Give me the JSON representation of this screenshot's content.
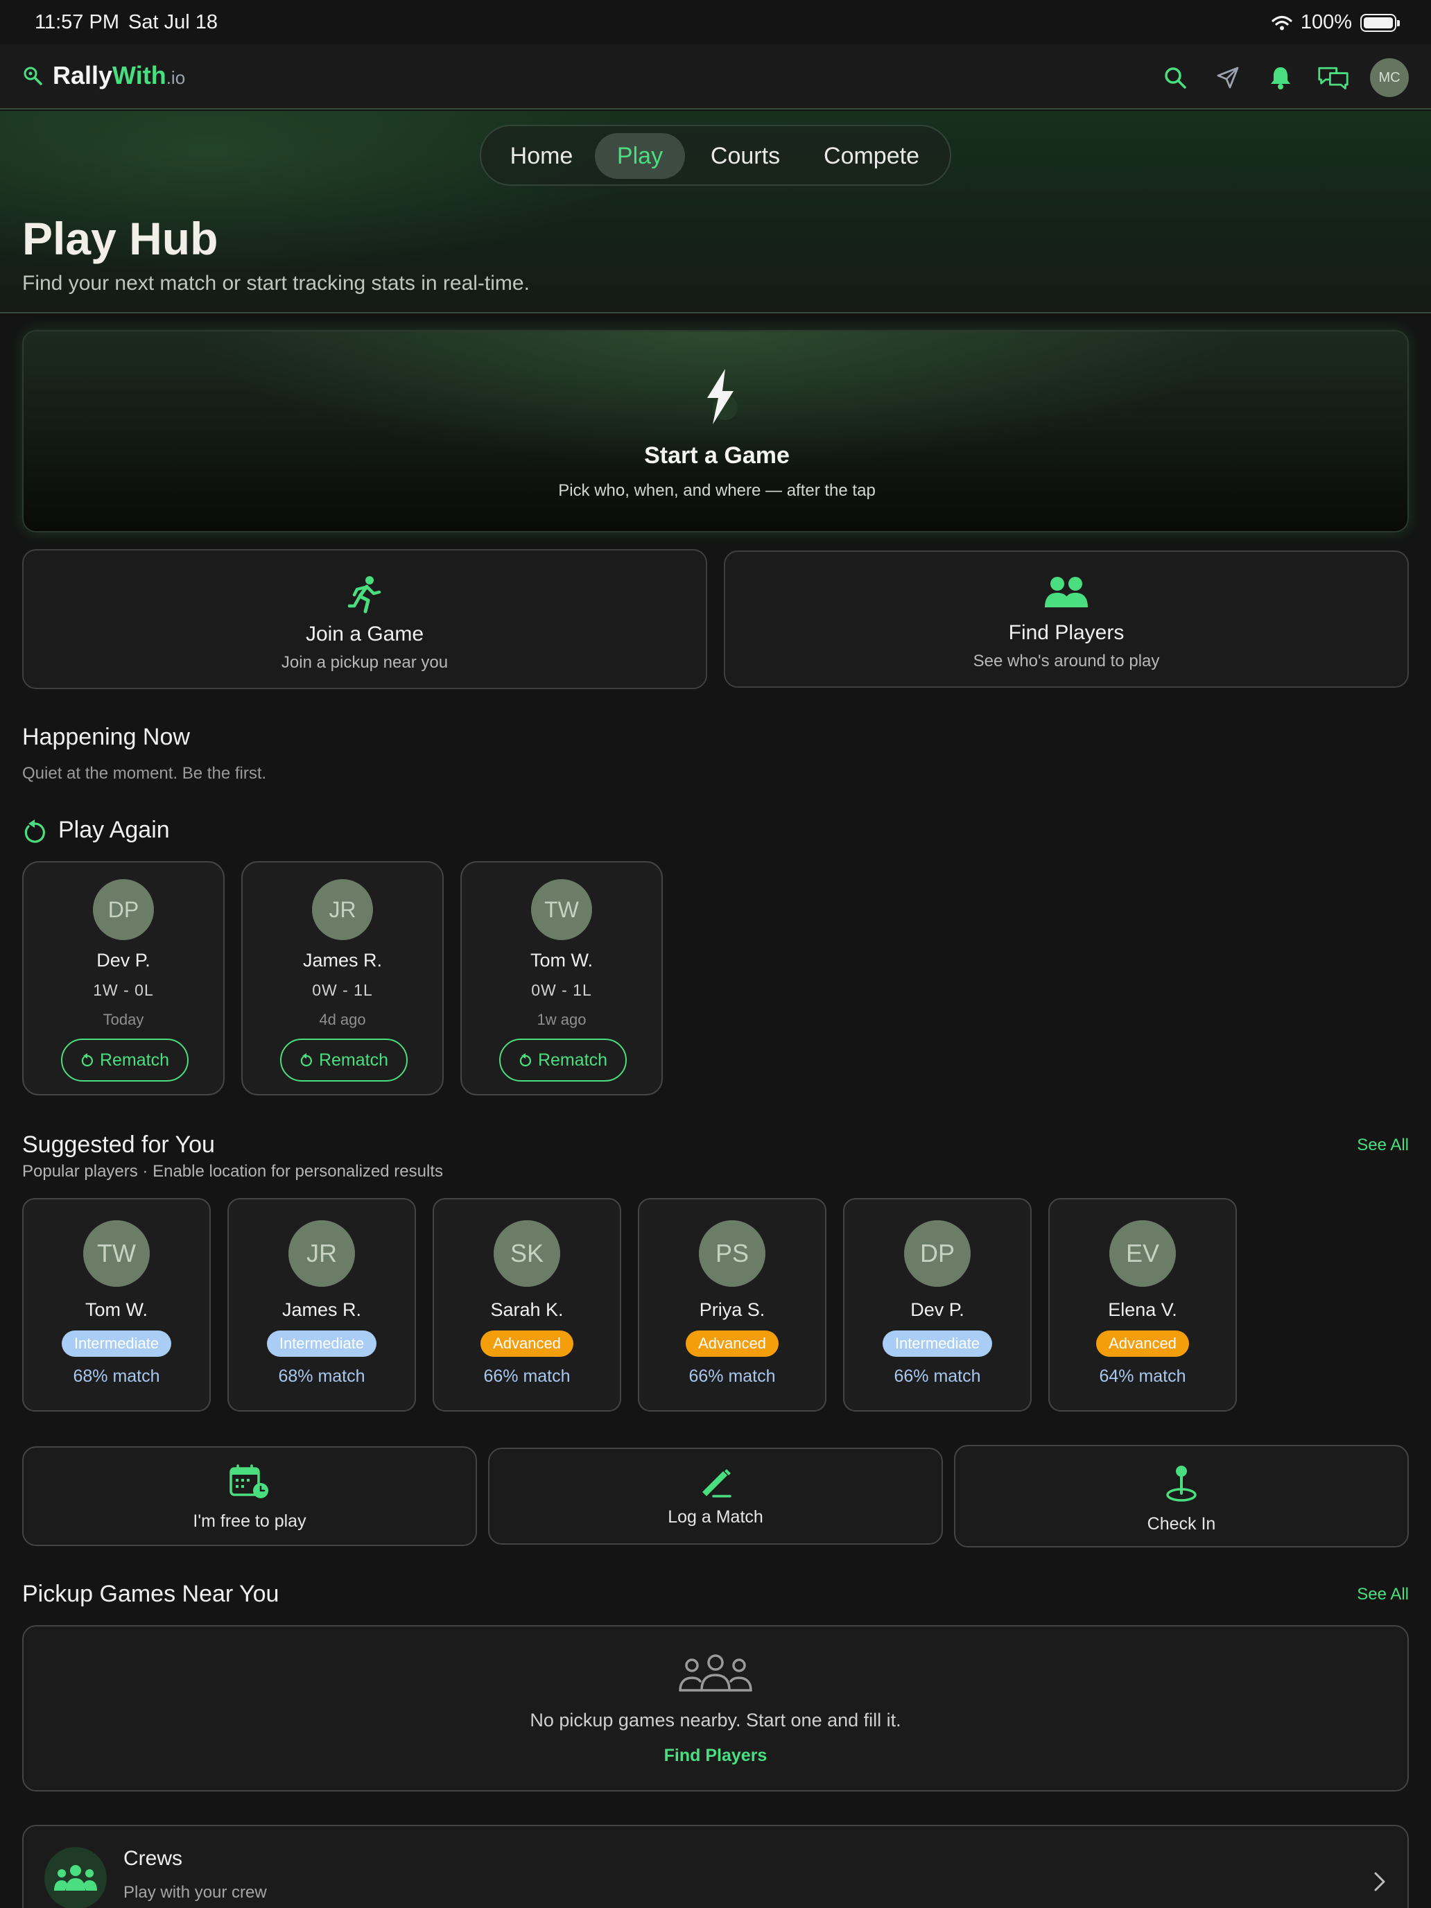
{
  "status_bar": {
    "time": "11:57 PM",
    "date": "Sat Jul 18",
    "battery": "100%"
  },
  "header": {
    "brand_main": "Rally",
    "brand_accent": "With",
    "brand_tld": ".io",
    "avatar_initials": "MC",
    "icons": [
      "search-icon",
      "send-icon",
      "bell-icon",
      "chat-icon"
    ]
  },
  "tabs": [
    {
      "label": "Home",
      "active": false
    },
    {
      "label": "Play",
      "active": true
    },
    {
      "label": "Courts",
      "active": false
    },
    {
      "label": "Compete",
      "active": false
    }
  ],
  "hero": {
    "title": "Play Hub",
    "subtitle": "Find your next match or start tracking stats in real-time."
  },
  "start_game": {
    "title": "Start a Game",
    "subtitle": "Pick who, when, and where — after the tap"
  },
  "actions": [
    {
      "title": "Join a Game",
      "subtitle": "Join a pickup near you",
      "icon": "running-icon"
    },
    {
      "title": "Find Players",
      "subtitle": "See who's around to play",
      "icon": "players-icon"
    }
  ],
  "happening_now": {
    "title": "Happening Now",
    "subtitle": "Quiet at the moment. Be the first."
  },
  "play_again": {
    "title": "Play Again",
    "players": [
      {
        "initials": "DP",
        "name": "Dev P.",
        "record": "1W - 0L",
        "when": "Today",
        "button": "Rematch"
      },
      {
        "initials": "JR",
        "name": "James R.",
        "record": "0W - 1L",
        "when": "4d ago",
        "button": "Rematch"
      },
      {
        "initials": "TW",
        "name": "Tom W.",
        "record": "0W - 1L",
        "when": "1w ago",
        "button": "Rematch"
      }
    ]
  },
  "suggested": {
    "title": "Suggested for You",
    "subtitle": "Popular players · Enable location for personalized results",
    "see_all": "See All",
    "players": [
      {
        "initials": "TW",
        "name": "Tom W.",
        "level": "Intermediate",
        "match": "68% match"
      },
      {
        "initials": "JR",
        "name": "James R.",
        "level": "Intermediate",
        "match": "68% match"
      },
      {
        "initials": "SK",
        "name": "Sarah K.",
        "level": "Advanced",
        "match": "66% match"
      },
      {
        "initials": "PS",
        "name": "Priya S.",
        "level": "Advanced",
        "match": "66% match"
      },
      {
        "initials": "DP",
        "name": "Dev P.",
        "level": "Intermediate",
        "match": "66% match"
      },
      {
        "initials": "EV",
        "name": "Elena V.",
        "level": "Advanced",
        "match": "64% match"
      }
    ]
  },
  "quick_actions": [
    {
      "label": "I'm free to play",
      "icon": "calendar-clock-icon"
    },
    {
      "label": "Log a Match",
      "icon": "pencil-icon"
    },
    {
      "label": "Check In",
      "icon": "location-pin-icon"
    }
  ],
  "pickup": {
    "title": "Pickup Games Near You",
    "see_all": "See All",
    "empty_message": "No pickup games nearby. Start one and fill it.",
    "link": "Find Players"
  },
  "crews": {
    "title": "Crews",
    "subtitle": "Play with your crew"
  },
  "colors": {
    "accent": "#4ade80",
    "background": "#141414",
    "intermediate": "#a9cdf5",
    "advanced": "#f59e0b"
  }
}
